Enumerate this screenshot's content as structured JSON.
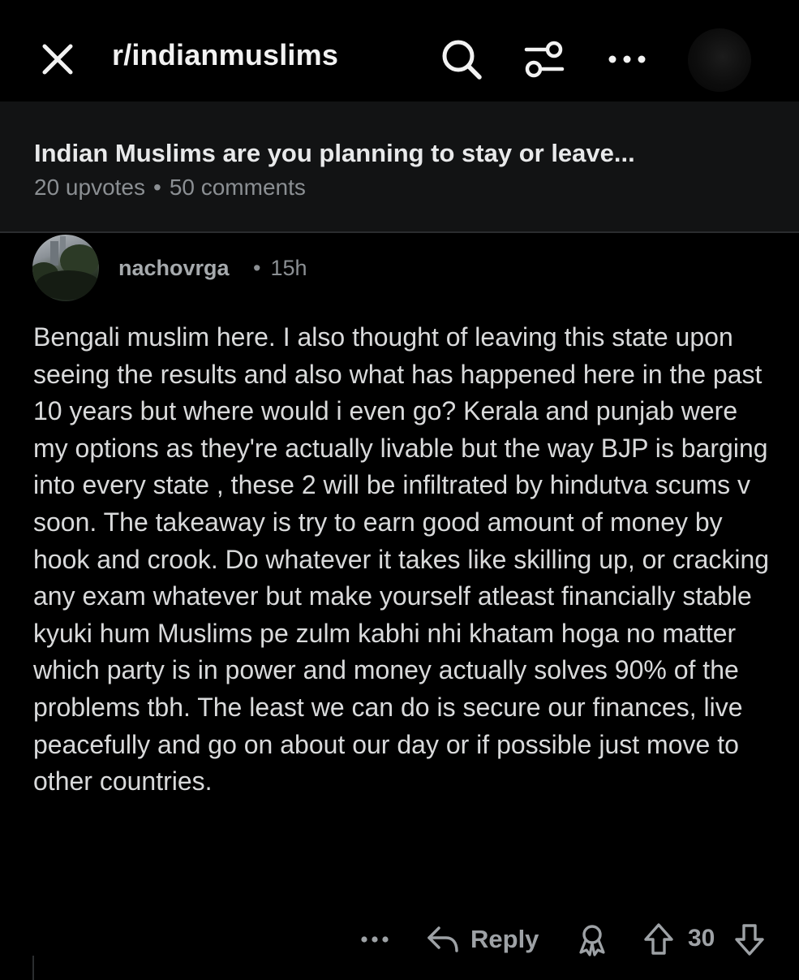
{
  "topbar": {
    "subreddit": "r/indianmuslims"
  },
  "post": {
    "title": "Indian Muslims are you planning to stay or leave...",
    "upvotes": "20 upvotes",
    "separator": "•",
    "comments": "50 comments"
  },
  "comment": {
    "author": "nachovrga",
    "separator": "•",
    "time": "15h",
    "body": "Bengali muslim here. I also thought of leaving this state upon seeing the results and also what has happened here in the past 10 years but where would i even go? Kerala and punjab were my options as they're actually livable but the way BJP is barging into every state , these 2 will be infiltrated by hindutva scums v soon. The takeaway is try to earn good amount of money by hook and crook. Do whatever it takes like skilling up, or cracking any exam whatever but make yourself atleast financially stable kyuki hum Muslims pe zulm kabhi nhi khatam hoga no matter which party is in power and money actually solves 90% of the problems tbh. The least we can do is secure our finances, live peacefully and go on about our day or if possible just move to other countries.",
    "reply_label": "Reply",
    "vote_count": "30"
  },
  "icons": {
    "close": "close-icon",
    "search": "search-icon",
    "filter": "filter-icon",
    "more": "more-icon",
    "reply": "reply-arrow-icon",
    "award": "award-icon",
    "upvote": "upvote-icon",
    "downvote": "downvote-icon"
  },
  "colors": {
    "background": "#000000",
    "header_panel": "#121314",
    "primary_text": "#d9dadb",
    "muted_text": "#8b8f93"
  }
}
